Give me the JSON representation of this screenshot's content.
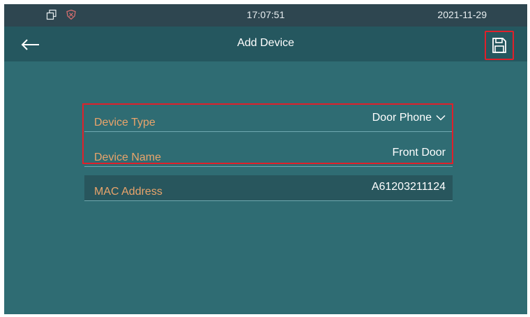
{
  "status_bar": {
    "time": "17:07:51",
    "date": "2021-11-29",
    "icons": [
      "windows-icon",
      "shield-x-icon"
    ]
  },
  "nav": {
    "title": "Add Device",
    "back_icon": "arrow-left-icon",
    "save_icon": "floppy-disk-icon"
  },
  "form": {
    "device_type": {
      "label": "Device Type",
      "value": "Door Phone"
    },
    "device_name": {
      "label": "Device Name",
      "value": "Front Door"
    },
    "mac_address": {
      "label": "MAC Address",
      "value": "A61203211124"
    }
  },
  "colors": {
    "accent_label": "#e9a46b",
    "highlight": "#e0202a",
    "background": "#2f6c73"
  }
}
